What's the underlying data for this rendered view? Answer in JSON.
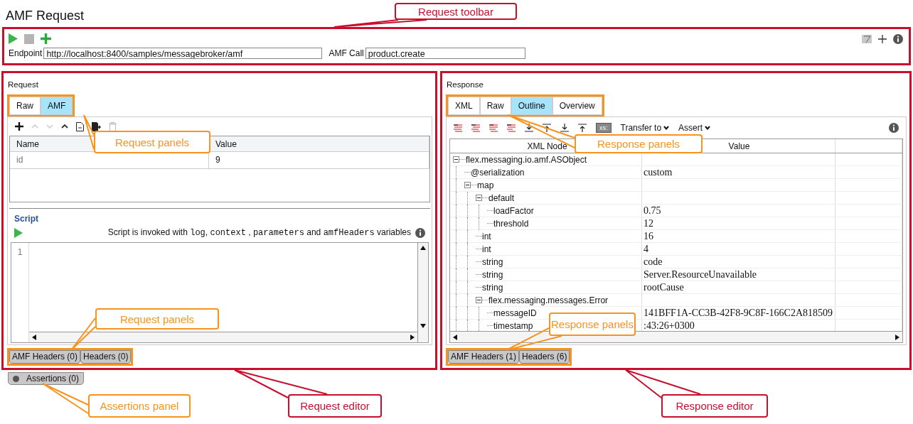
{
  "title": "AMF Request",
  "toolbar": {
    "endpoint": {
      "label": "Endpoint",
      "value": "http://localhost:8400/samples/messagebroker/amf"
    },
    "amf_call": {
      "label": "AMF Call",
      "value": "product.create"
    }
  },
  "request": {
    "title": "Request",
    "tabs": [
      {
        "label": "Raw",
        "selected": false
      },
      {
        "label": "AMF",
        "selected": true
      }
    ],
    "table": {
      "columns": [
        "Name",
        "Value"
      ],
      "rows": [
        [
          "id",
          "9"
        ]
      ]
    },
    "script": {
      "title": "Script",
      "hint": [
        {
          "text": "Script is invoked with ",
          "code": false
        },
        {
          "text": "log",
          "code": true
        },
        {
          "text": ", ",
          "code": false
        },
        {
          "text": "context",
          "code": true
        },
        {
          "text": " , ",
          "code": false
        },
        {
          "text": "parameters",
          "code": true
        },
        {
          "text": " and ",
          "code": false
        },
        {
          "text": "amfHeaders",
          "code": true
        },
        {
          "text": " variables",
          "code": false
        }
      ],
      "line_numbers": [
        "1"
      ]
    },
    "bottom_tabs": [
      "AMF Headers (0)",
      "Headers (0)"
    ]
  },
  "assertions": {
    "label": "Assertions (0)"
  },
  "response": {
    "title": "Response",
    "tabs": [
      {
        "label": "XML",
        "selected": false
      },
      {
        "label": "Raw",
        "selected": false
      },
      {
        "label": "Outline",
        "selected": true
      },
      {
        "label": "Overview",
        "selected": false
      }
    ],
    "toolbar": {
      "xs_label": "xs:",
      "menus": [
        "Transfer to",
        "Assert"
      ]
    },
    "tree": {
      "columns": [
        "XML Node",
        "Value"
      ],
      "nodes": [
        {
          "name": "flex.messaging.io.amf.ASObject",
          "expanded": true,
          "children": [
            {
              "name": "@serialization",
              "value": "custom"
            },
            {
              "name": "map",
              "expanded": true,
              "children": [
                {
                  "name": "default",
                  "expanded": true,
                  "children": [
                    {
                      "name": "loadFactor",
                      "value": "0.75"
                    },
                    {
                      "name": "threshold",
                      "value": "12"
                    }
                  ]
                },
                {
                  "name": "int",
                  "value": "16"
                },
                {
                  "name": "int",
                  "value": "4"
                },
                {
                  "name": "string",
                  "value": "code"
                },
                {
                  "name": "string",
                  "value": "Server.ResourceUnavailable"
                },
                {
                  "name": "string",
                  "value": "rootCause"
                },
                {
                  "name": "flex.messaging.messages.Error",
                  "expanded": true,
                  "children": [
                    {
                      "name": "messageID",
                      "value": "141BFF1A-CC3B-42F8-9C8F-166C2A818509"
                    },
                    {
                      "name": "timestamp",
                      "value": ":43:26+0300"
                    }
                  ]
                }
              ]
            }
          ]
        }
      ]
    },
    "bottom_tabs": [
      "AMF Headers (1)",
      "Headers (6)"
    ]
  },
  "annotations": [
    {
      "text": "Request toolbar",
      "color": "#c8102e"
    },
    {
      "text": "Request panels",
      "color": "#f7931e"
    },
    {
      "text": "Request panels",
      "color": "#f7931e"
    },
    {
      "text": "Assertions panel",
      "color": "#f7931e"
    },
    {
      "text": "Request editor",
      "color": "#c8102e"
    },
    {
      "text": "Response panels",
      "color": "#f7931e"
    },
    {
      "text": "Response panels",
      "color": "#f7931e"
    },
    {
      "text": "Response editor",
      "color": "#c8102e"
    }
  ]
}
